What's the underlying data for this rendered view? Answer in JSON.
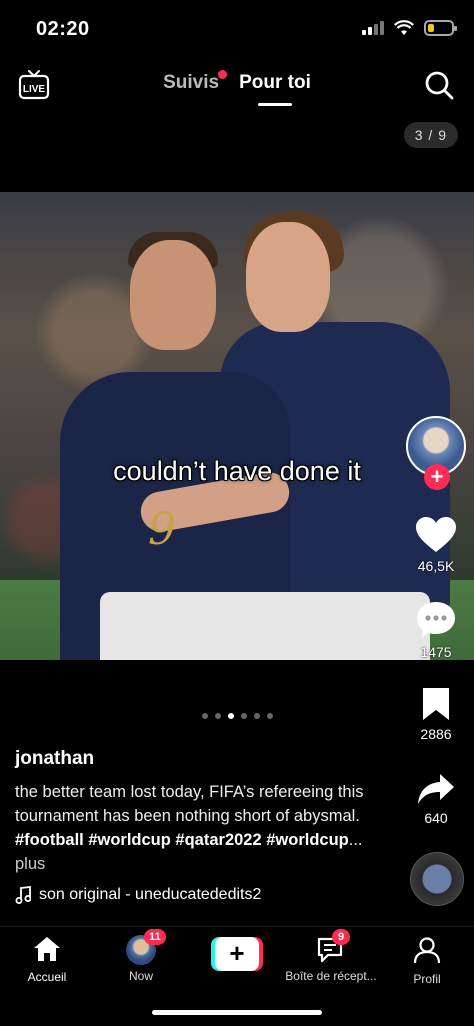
{
  "status_bar": {
    "time": "02:20"
  },
  "top_nav": {
    "live_label": "LIVE",
    "tab_following": "Suivis",
    "tab_for_you": "Pour toi"
  },
  "counter": "3 / 9",
  "photo": {
    "caption_overlay": "couldn’t have done it",
    "jersey_number": "9"
  },
  "actions": {
    "likes": "46,5K",
    "comments": "1475",
    "bookmarks": "2886",
    "shares": "640"
  },
  "carousel": {
    "total": 6,
    "active_index": 2
  },
  "post": {
    "username": "jonathan",
    "description_text": "the better team lost today, FIFA’s refereeing this tournament has been nothing short of abysmal.",
    "hashtags": "#football #worldcup #qatar2022 #worldcup",
    "ellipsis": "...",
    "more_label": "plus",
    "sound": "son original - uneducatededits2"
  },
  "bottom_nav": {
    "home": "Accueil",
    "now": "Now",
    "now_badge": "11",
    "inbox": "Boîte de récept...",
    "inbox_badge": "9",
    "profile": "Profil"
  },
  "colors": {
    "accent": "#fe2c55",
    "cyan": "#25f4ee",
    "background": "#000000"
  },
  "icons": [
    "live-tv-icon",
    "search-icon",
    "heart-icon",
    "comment-icon",
    "bookmark-icon",
    "share-icon",
    "music-note-icon",
    "home-icon",
    "inbox-icon",
    "profile-icon"
  ]
}
